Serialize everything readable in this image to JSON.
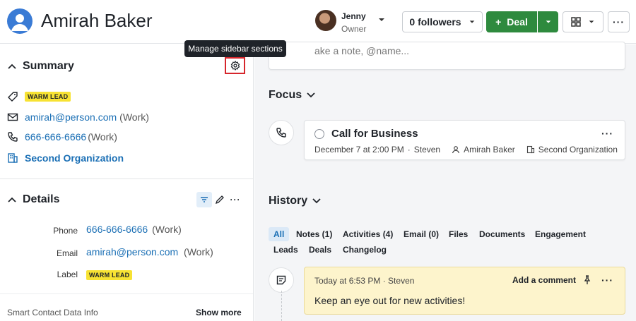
{
  "header": {
    "person_name": "Amirah Baker",
    "owner_name": "Jenny",
    "owner_role": "Owner",
    "followers_label": "0 followers",
    "deal_label": "Deal",
    "deal_plus": "+",
    "more_label": "···",
    "accent_green": "#2e8a3e"
  },
  "tooltip": {
    "text": "Manage sidebar sections"
  },
  "summary": {
    "title": "Summary",
    "label_badge": "WARM LEAD",
    "email": "amirah@person.com",
    "email_type": "(Work)",
    "phone": "666-666-6666",
    "phone_type": "(Work)",
    "organization": "Second Organization"
  },
  "details": {
    "title": "Details",
    "phone_label": "Phone",
    "phone": "666-666-6666",
    "phone_type": "(Work)",
    "email_label": "Email",
    "email": "amirah@person.com",
    "email_type": "(Work)",
    "label_label": "Label",
    "label_badge": "WARM LEAD",
    "more_label": "···"
  },
  "footer": {
    "smart_contact": "Smart Contact Data Info",
    "show_more": "Show more"
  },
  "note_input": {
    "placeholder": "ake a note, @name..."
  },
  "focus": {
    "title": "Focus",
    "activity": {
      "title": "Call for Business",
      "when": "December 7 at 2:00 PM",
      "separator": "·",
      "assignee": "Steven",
      "person": "Amirah Baker",
      "organization": "Second Organization",
      "more": "···"
    }
  },
  "history": {
    "title": "History",
    "tabs": [
      {
        "label": "All",
        "active": true
      },
      {
        "label": "Notes (1)",
        "active": false
      },
      {
        "label": "Activities (4)",
        "active": false
      },
      {
        "label": "Email (0)",
        "active": false
      },
      {
        "label": "Files",
        "active": false
      },
      {
        "label": "Documents",
        "active": false
      },
      {
        "label": "Engagement",
        "active": false
      },
      {
        "label": "Leads",
        "active": false
      },
      {
        "label": "Deals",
        "active": false
      },
      {
        "label": "Changelog",
        "active": false
      }
    ],
    "note": {
      "meta": "Today at 6:53 PM · Steven",
      "add_comment": "Add a comment",
      "text": "Keep an eye out for new activities!",
      "more": "···"
    }
  },
  "icons": {
    "avatar": "person-avatar-icon",
    "gear": "gear-icon",
    "tag": "tag-icon",
    "mail": "mail-icon",
    "phone": "phone-icon",
    "building": "building-icon",
    "filter": "filter-icon",
    "pencil": "pencil-icon",
    "grid": "grid-view-icon",
    "pin": "pin-icon",
    "note": "note-icon"
  }
}
